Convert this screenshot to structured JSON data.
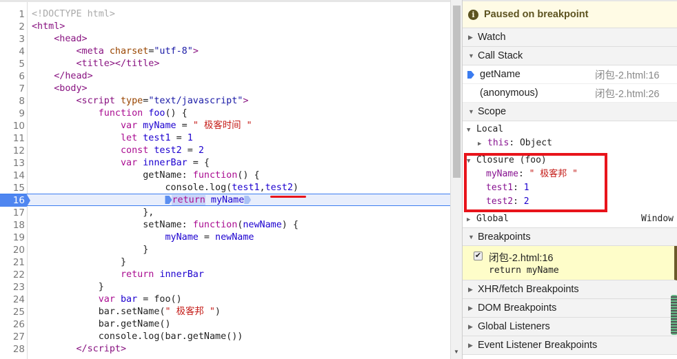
{
  "editor": {
    "current_line": 16,
    "lines": [
      [
        [
          "<!DOCTYPE html>",
          "dt"
        ]
      ],
      [
        [
          "<html>",
          "tag"
        ]
      ],
      [
        [
          "    <head>",
          "tag"
        ]
      ],
      [
        [
          "        <meta ",
          "tag"
        ],
        [
          "charset",
          "attr"
        ],
        [
          "=",
          "def"
        ],
        [
          "\"utf-8\"",
          "val"
        ],
        [
          ">",
          "tag"
        ]
      ],
      [
        [
          "        <title></title>",
          "tag"
        ]
      ],
      [
        [
          "    </head>",
          "tag"
        ]
      ],
      [
        [
          "    <body>",
          "tag"
        ]
      ],
      [
        [
          "        <script ",
          "tag"
        ],
        [
          "type",
          "attr"
        ],
        [
          "=",
          "def"
        ],
        [
          "\"text/javascript\"",
          "val"
        ],
        [
          ">",
          "tag"
        ]
      ],
      [
        [
          "            function ",
          "kw"
        ],
        [
          "foo",
          "var"
        ],
        [
          "() {",
          "def"
        ]
      ],
      [
        [
          "                var ",
          "kw"
        ],
        [
          "myName",
          "var"
        ],
        [
          " = ",
          "def"
        ],
        [
          "\" 极客时间 \"",
          "str"
        ]
      ],
      [
        [
          "                let ",
          "kw"
        ],
        [
          "test1",
          "var"
        ],
        [
          " = ",
          "def"
        ],
        [
          "1",
          "var"
        ]
      ],
      [
        [
          "                const ",
          "kw"
        ],
        [
          "test2",
          "var"
        ],
        [
          " = ",
          "def"
        ],
        [
          "2",
          "var"
        ]
      ],
      [
        [
          "                var ",
          "kw"
        ],
        [
          "innerBar",
          "var"
        ],
        [
          " = {",
          "def"
        ]
      ],
      [
        [
          "                    getName: ",
          "def"
        ],
        [
          "function",
          "kw"
        ],
        [
          "() {",
          "def"
        ]
      ],
      [
        [
          "                        console.log(",
          "def"
        ],
        [
          "test1",
          "var"
        ],
        [
          ",",
          "def"
        ],
        [
          "test2",
          "var"
        ],
        [
          ")",
          "def"
        ]
      ],
      [
        [
          "                        ",
          "def"
        ],
        [
          "@bp",
          ""
        ],
        [
          "return",
          "kw ret"
        ],
        [
          " myName",
          "var"
        ],
        [
          "@bpl",
          ""
        ]
      ],
      [
        [
          "                    },",
          "def"
        ]
      ],
      [
        [
          "                    setName: ",
          "def"
        ],
        [
          "function",
          "kw"
        ],
        [
          "(",
          "def"
        ],
        [
          "newName",
          "var"
        ],
        [
          ") {",
          "def"
        ]
      ],
      [
        [
          "                        myName",
          "var"
        ],
        [
          " = ",
          "def"
        ],
        [
          "newName",
          "var"
        ]
      ],
      [
        [
          "                    }",
          "def"
        ]
      ],
      [
        [
          "                }",
          "def"
        ]
      ],
      [
        [
          "                return ",
          "kw"
        ],
        [
          "innerBar",
          "var"
        ]
      ],
      [
        [
          "            }",
          "def"
        ]
      ],
      [
        [
          "            var ",
          "kw"
        ],
        [
          "bar",
          "var"
        ],
        [
          " = foo()",
          "def"
        ]
      ],
      [
        [
          "            bar.setName(",
          "def"
        ],
        [
          "\" 极客邦 \"",
          "str"
        ],
        [
          ")",
          "def"
        ]
      ],
      [
        [
          "            bar.getName()",
          "def"
        ]
      ],
      [
        [
          "            console.log(bar.getName())",
          "def"
        ]
      ],
      [
        [
          "        </script>",
          "tag"
        ]
      ]
    ]
  },
  "debugger": {
    "paused_label": "Paused on breakpoint",
    "watch": "Watch",
    "call_stack": "Call Stack",
    "frames": [
      {
        "name": "getName",
        "location": "闭包-2.html:16",
        "active": true
      },
      {
        "name": "(anonymous)",
        "location": "闭包-2.html:26",
        "active": false
      }
    ],
    "scope": "Scope",
    "local": "Local",
    "this_key": "this",
    "this_val": "Object",
    "closure": "Closure (foo)",
    "closure_vars": [
      {
        "key": "myName",
        "value": "\" 极客邦 \"",
        "type": "string"
      },
      {
        "key": "test1",
        "value": "1",
        "type": "number"
      },
      {
        "key": "test2",
        "value": "2",
        "type": "number"
      }
    ],
    "global": "Global",
    "global_val": "Window",
    "breakpoints": "Breakpoints",
    "breakpoint_item": {
      "location": "闭包-2.html:16",
      "code": "return myName",
      "checked": true
    },
    "xhr": "XHR/fetch Breakpoints",
    "dom": "DOM Breakpoints",
    "global_listeners": "Global Listeners",
    "event_listeners": "Event Listener Breakpoints"
  },
  "colors": {
    "highlight": "#e8141b",
    "accent": "#3b7cf0"
  }
}
